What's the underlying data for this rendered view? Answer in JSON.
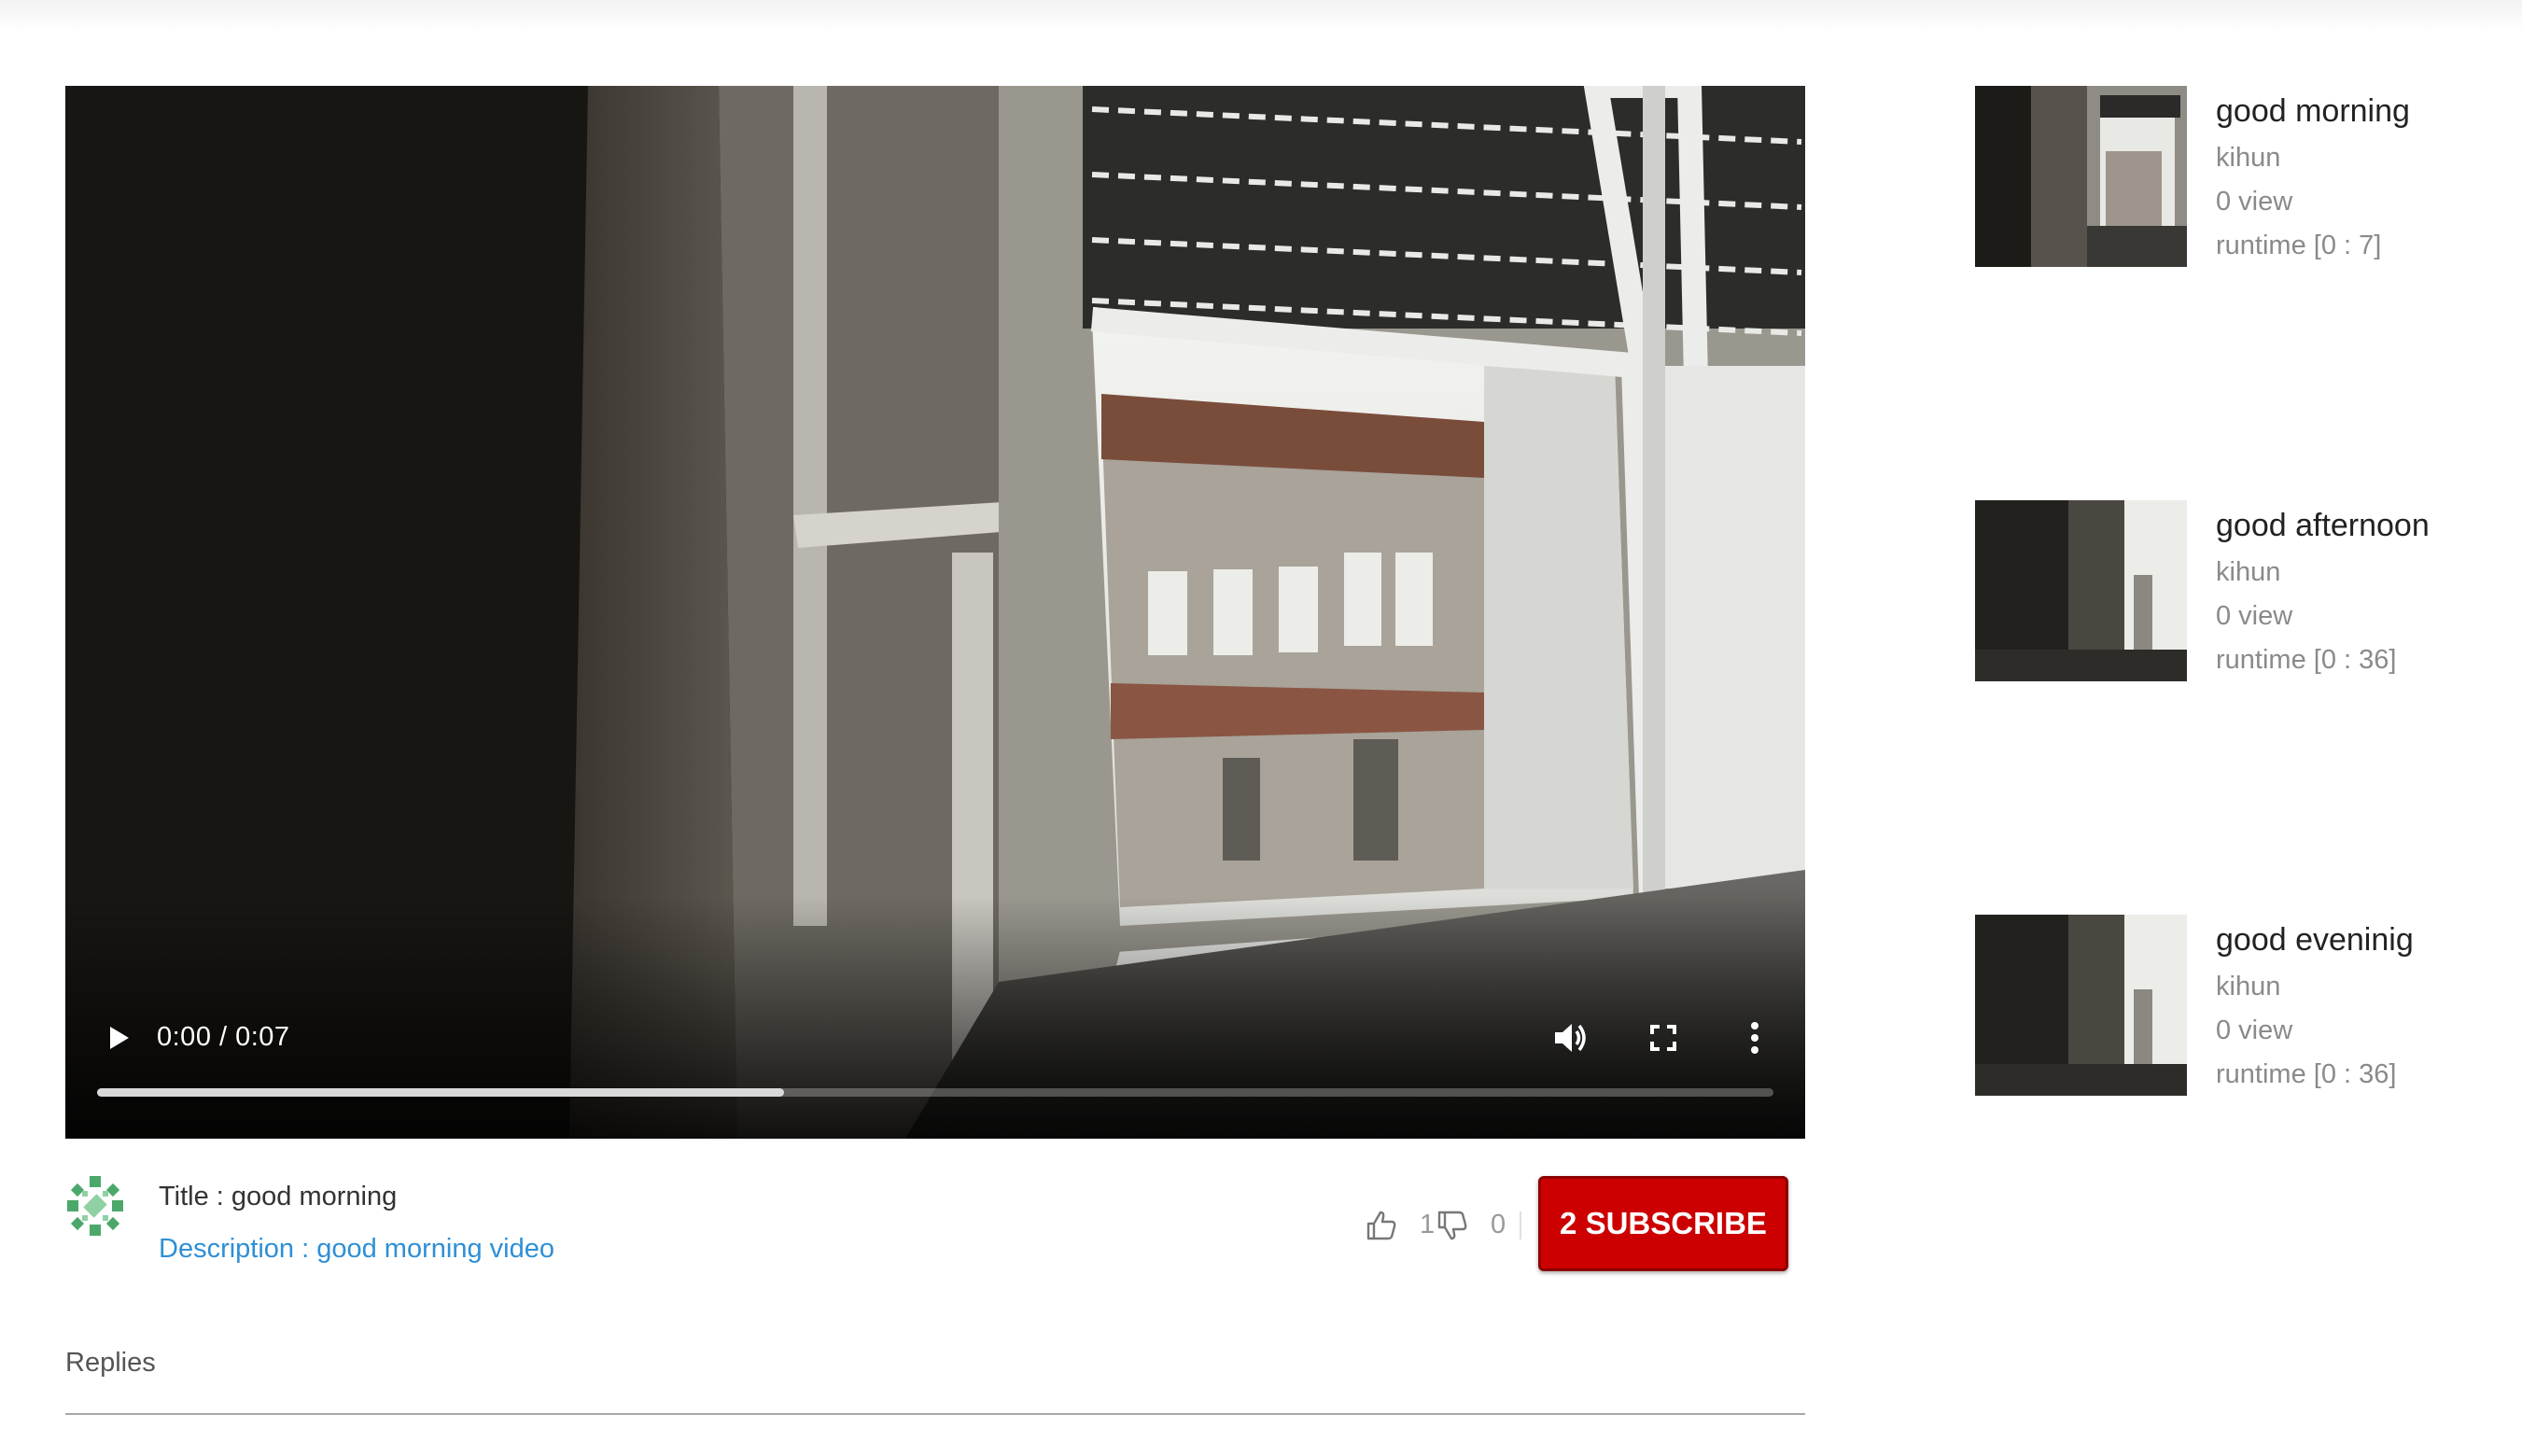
{
  "player": {
    "time_display": "0:00 / 0:07",
    "progress_fraction": 0.41
  },
  "video_info": {
    "title": "Title : good morning",
    "description": "Description : good morning video",
    "like_count": "1",
    "dislike_count": "0",
    "subscribe_label": "2 SUBSCRIBE"
  },
  "replies": {
    "label": "Replies"
  },
  "sidebar": {
    "items": [
      {
        "title": "good morning",
        "author": "kihun",
        "views": "0 view",
        "runtime": "runtime [0 : 7]"
      },
      {
        "title": "good afternoon",
        "author": "kihun",
        "views": "0 view",
        "runtime": "runtime [0 : 36]"
      },
      {
        "title": "good eveninig",
        "author": "kihun",
        "views": "0 view",
        "runtime": "runtime [0 : 36]"
      }
    ]
  },
  "colors": {
    "subscribe_bg": "#cc0000",
    "description_link": "#2f8fd6",
    "muted_text": "#8a8a8a"
  },
  "icons": [
    "play-icon",
    "volume-icon",
    "fullscreen-icon",
    "more-vert-icon",
    "thumbs-up-icon",
    "thumbs-down-icon"
  ]
}
